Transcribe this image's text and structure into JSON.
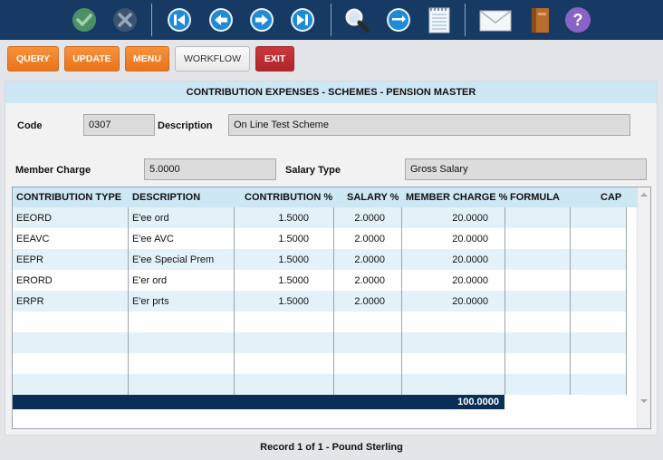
{
  "toolbar": {
    "icons": [
      "check-icon",
      "cancel-icon",
      "first-record-icon",
      "previous-record-icon",
      "next-record-icon",
      "last-record-icon",
      "search-icon",
      "refresh-icon",
      "notepad-icon",
      "mail-icon",
      "book-icon",
      "help-icon"
    ]
  },
  "actions": {
    "query": "QUERY",
    "update": "UPDATE",
    "menu": "MENU",
    "workflow": "WORKFLOW",
    "exit": "EXIT"
  },
  "colors": {
    "toolbar": "#163a63",
    "accent_orange": "#ef7d24",
    "exit_red": "#b92e33",
    "header_blue": "#cde7f5",
    "total_bar": "#092f58"
  },
  "panel": {
    "title": "CONTRIBUTION EXPENSES - SCHEMES - PENSION MASTER",
    "code_label": "Code",
    "code_value": "0307",
    "description_label": "Description",
    "description_value": "On Line Test Scheme",
    "member_charge_label": "Member Charge",
    "member_charge_value": "5.0000",
    "salary_type_label": "Salary Type",
    "salary_type_value": "Gross Salary"
  },
  "grid": {
    "columns": [
      "CONTRIBUTION TYPE",
      "DESCRIPTION",
      "CONTRIBUTION %",
      "SALARY %",
      "MEMBER CHARGE %",
      "FORMULA",
      "CAP"
    ],
    "rows": [
      {
        "type": "EEORD",
        "description": "E'ee ord",
        "contribution": "1.5000",
        "salary": "2.0000",
        "member_charge": "20.0000",
        "formula": "",
        "cap": ""
      },
      {
        "type": "EEAVC",
        "description": "E'ee AVC",
        "contribution": "1.5000",
        "salary": "2.0000",
        "member_charge": "20.0000",
        "formula": "",
        "cap": ""
      },
      {
        "type": "EEPR",
        "description": "E'ee Special Prem",
        "contribution": "1.5000",
        "salary": "2.0000",
        "member_charge": "20.0000",
        "formula": "",
        "cap": ""
      },
      {
        "type": "ERORD",
        "description": "E'er ord",
        "contribution": "1.5000",
        "salary": "2.0000",
        "member_charge": "20.0000",
        "formula": "",
        "cap": ""
      },
      {
        "type": "ERPR",
        "description": "E'er prts",
        "contribution": "1.5000",
        "salary": "2.0000",
        "member_charge": "20.0000",
        "formula": "",
        "cap": ""
      },
      {
        "type": "",
        "description": "",
        "contribution": "",
        "salary": "",
        "member_charge": "",
        "formula": "",
        "cap": ""
      },
      {
        "type": "",
        "description": "",
        "contribution": "",
        "salary": "",
        "member_charge": "",
        "formula": "",
        "cap": ""
      },
      {
        "type": "",
        "description": "",
        "contribution": "",
        "salary": "",
        "member_charge": "",
        "formula": "",
        "cap": ""
      },
      {
        "type": "",
        "description": "",
        "contribution": "",
        "salary": "",
        "member_charge": "",
        "formula": "",
        "cap": ""
      }
    ],
    "total": "100.0000"
  },
  "status": "Record 1 of 1 - Pound Sterling"
}
